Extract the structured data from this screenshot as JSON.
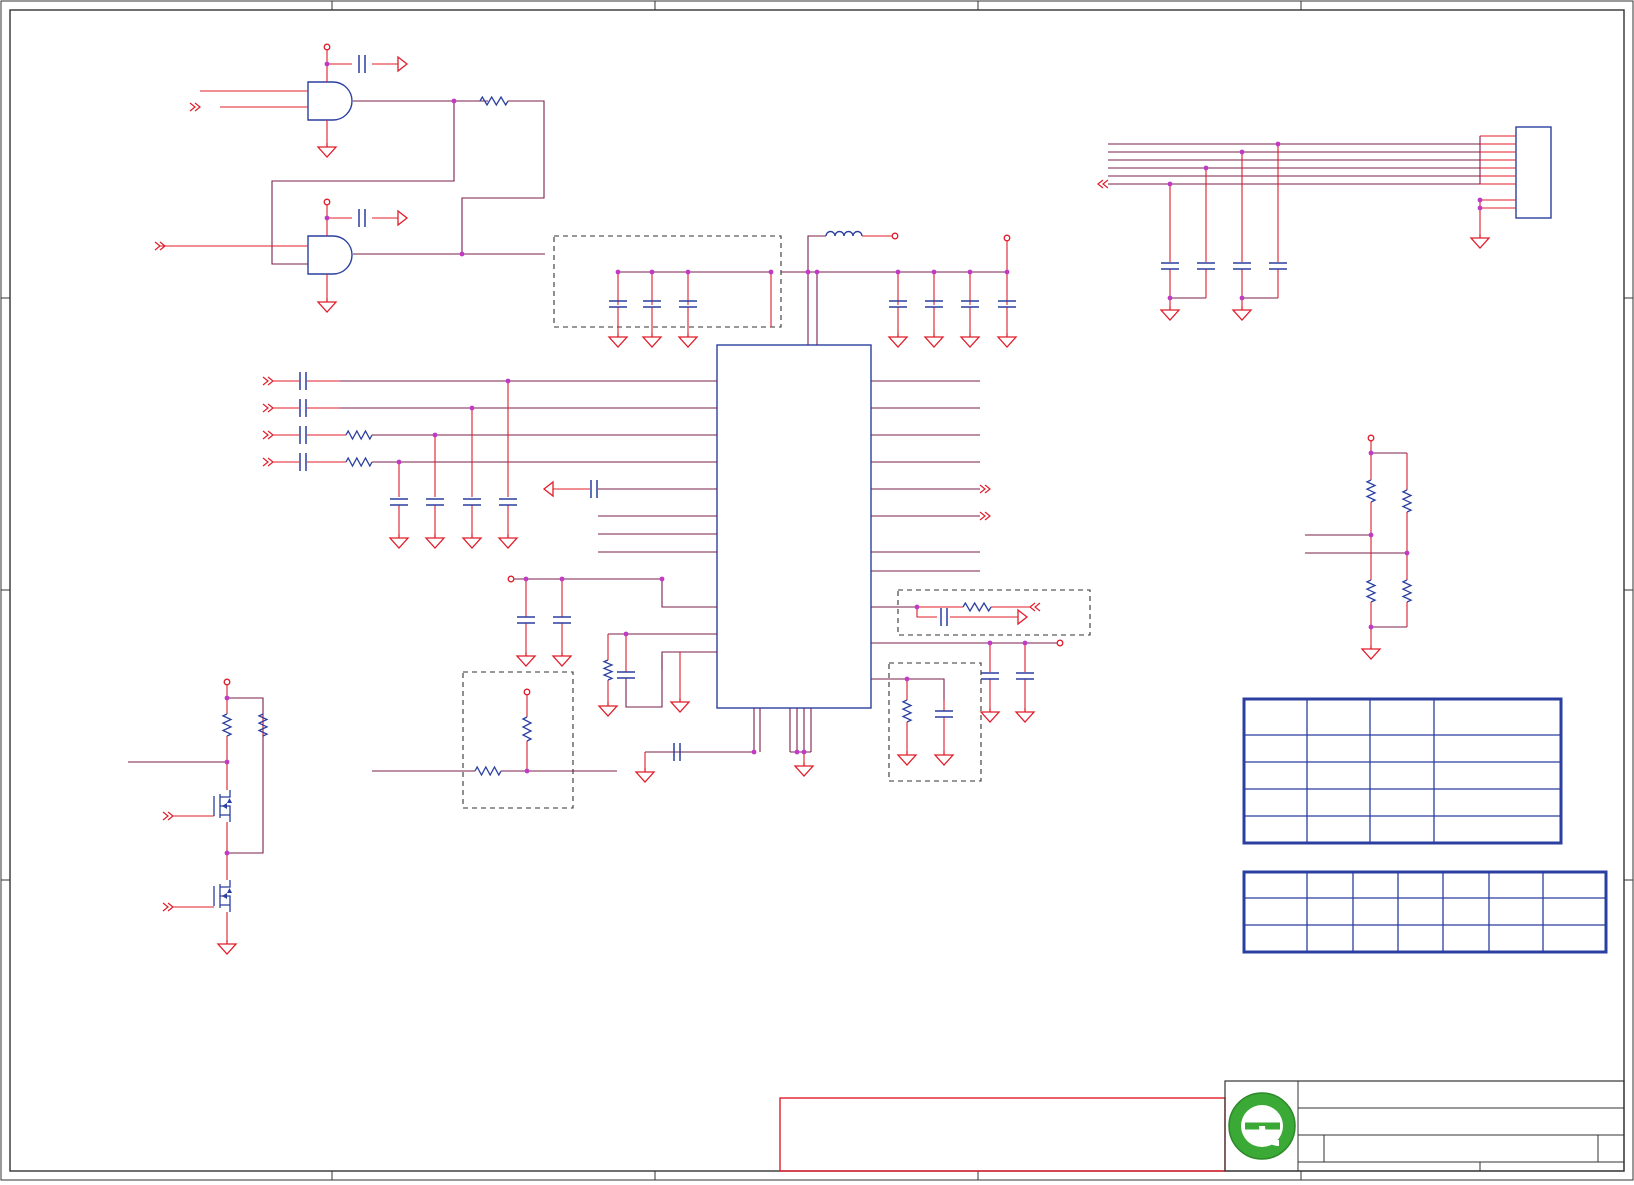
{
  "sheet": {
    "title_block_text": [],
    "revision_table": {
      "rows": 5,
      "cols": 4,
      "cells": []
    },
    "pin_table": {
      "rows": 3,
      "cols": 7,
      "cells": []
    },
    "notes": []
  },
  "logo": {
    "name": "company-logo-green-e"
  },
  "colors": {
    "wire": "#7a1f4b",
    "stub": "#e11d2a",
    "part": "#2b3fa0",
    "junction": "#c23ac4",
    "border": "#333333",
    "frame_accent": "#e11d2a",
    "logo_green": "#3aa935"
  }
}
